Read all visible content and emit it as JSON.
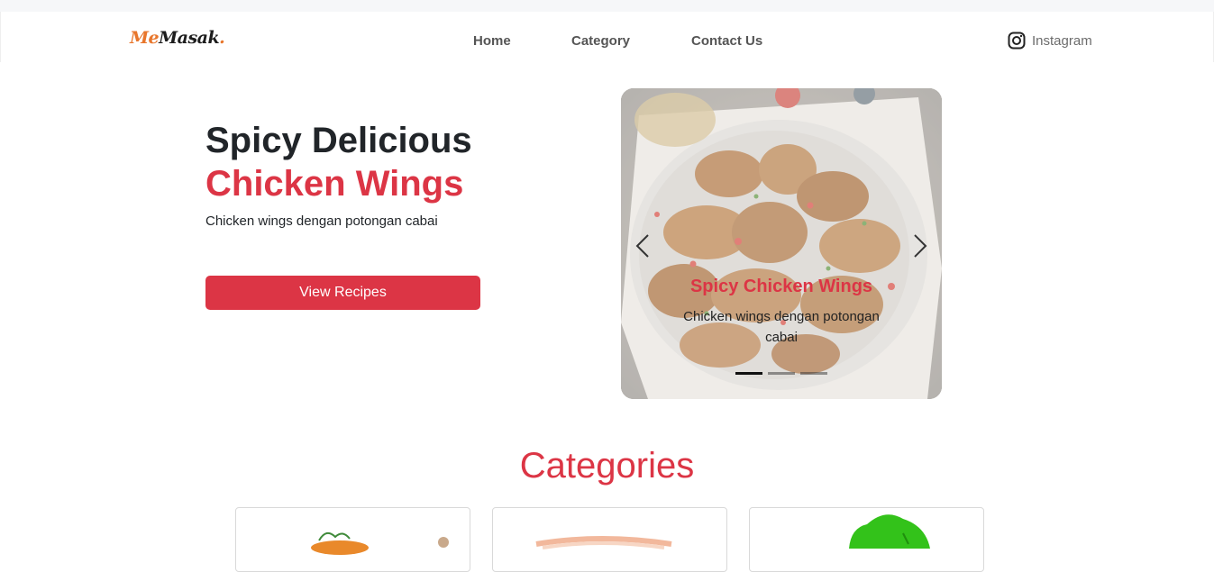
{
  "brand": {
    "me": "Me",
    "masak": "Masak",
    "dot": "."
  },
  "nav": {
    "links": [
      {
        "label": "Home"
      },
      {
        "label": "Category"
      },
      {
        "label": "Contact Us"
      }
    ],
    "instagram_label": "Instagram"
  },
  "hero": {
    "title_line1": "Spicy Delicious",
    "title_line2": "Chicken Wings",
    "subtitle": "Chicken wings dengan potongan cabai",
    "button_label": "View Recipes"
  },
  "carousel": {
    "caption_title": "Spicy Chicken Wings",
    "caption_text": "Chicken wings dengan potongan cabai",
    "slide_count": 3,
    "active_slide": 1
  },
  "categories": {
    "title": "Categories",
    "cards": [
      {
        "icon": "noodle-dish-icon"
      },
      {
        "icon": "drink-icon"
      },
      {
        "icon": "vegetable-icon"
      }
    ]
  },
  "colors": {
    "accent": "#dc3545",
    "brand_orange": "#e8762c",
    "text_dark": "#212529"
  }
}
